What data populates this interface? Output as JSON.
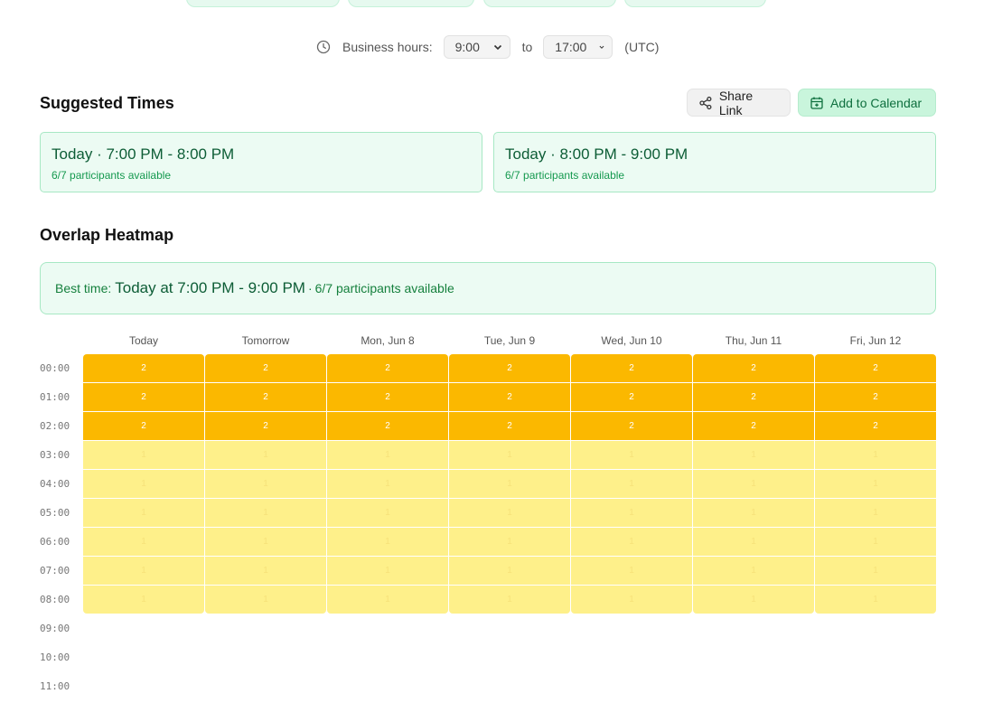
{
  "business_hours": {
    "label": "Business hours:",
    "start": "9:00",
    "to_label": "to",
    "end": "17:00",
    "timezone": "(UTC)"
  },
  "suggested": {
    "title": "Suggested Times",
    "share_label": "Share Link",
    "calendar_label": "Add to Calendar",
    "cards": [
      {
        "time": "Today · 7:00 PM - 8:00 PM",
        "availability": "6/7 participants available"
      },
      {
        "time": "Today · 8:00 PM - 9:00 PM",
        "availability": "6/7 participants available"
      }
    ]
  },
  "heatmap": {
    "title": "Overlap Heatmap",
    "best": {
      "prefix": "Best time:",
      "time": "Today at 7:00 PM - 9:00 PM",
      "separator": "·",
      "availability": "6/7 participants available"
    },
    "days": [
      "Today",
      "Tomorrow",
      "Mon, Jun 8",
      "Tue, Jun 9",
      "Wed, Jun 10",
      "Thu, Jun 11",
      "Fri, Jun 12"
    ],
    "hours": [
      "00:00",
      "01:00",
      "02:00",
      "03:00",
      "04:00",
      "05:00",
      "06:00",
      "07:00",
      "08:00",
      "09:00",
      "10:00",
      "11:00"
    ],
    "counts": [
      [
        2,
        2,
        2,
        2,
        2,
        2,
        2
      ],
      [
        2,
        2,
        2,
        2,
        2,
        2,
        2
      ],
      [
        2,
        2,
        2,
        2,
        2,
        2,
        2
      ],
      [
        1,
        1,
        1,
        1,
        1,
        1,
        1
      ],
      [
        1,
        1,
        1,
        1,
        1,
        1,
        1
      ],
      [
        1,
        1,
        1,
        1,
        1,
        1,
        1
      ],
      [
        1,
        1,
        1,
        1,
        1,
        1,
        1
      ],
      [
        1,
        1,
        1,
        1,
        1,
        1,
        1
      ],
      [
        1,
        1,
        1,
        1,
        1,
        1,
        1
      ]
    ],
    "colors": {
      "two": "#fbb800",
      "one": "#fef08a"
    }
  },
  "icons": [
    "clock-icon",
    "chevron-down-icon",
    "share-icon",
    "calendar-add-icon"
  ]
}
